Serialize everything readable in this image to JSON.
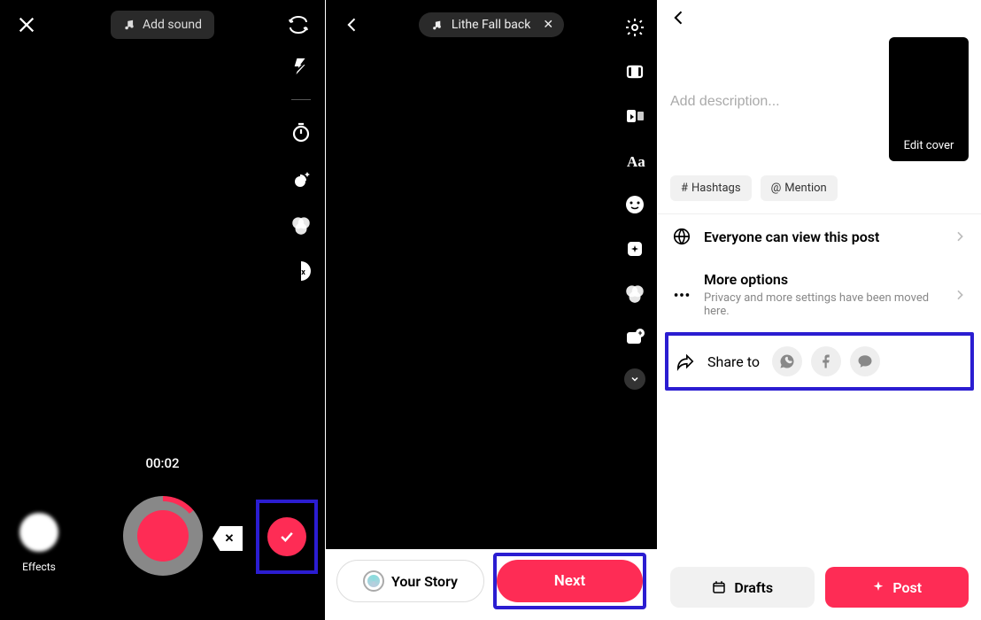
{
  "screen1": {
    "add_sound": "Add sound",
    "timer": "00:02",
    "effects_label": "Effects"
  },
  "screen2": {
    "sound_name": "Lithe Fall back",
    "your_story": "Your Story",
    "next": "Next"
  },
  "screen3": {
    "desc_placeholder": "Add description...",
    "edit_cover": "Edit cover",
    "hashtags_chip": "Hashtags",
    "mention_chip": "Mention",
    "privacy_title": "Everyone can view this post",
    "more_title": "More options",
    "more_sub": "Privacy and more settings have been moved here.",
    "share_to": "Share to",
    "drafts": "Drafts",
    "post": "Post"
  }
}
